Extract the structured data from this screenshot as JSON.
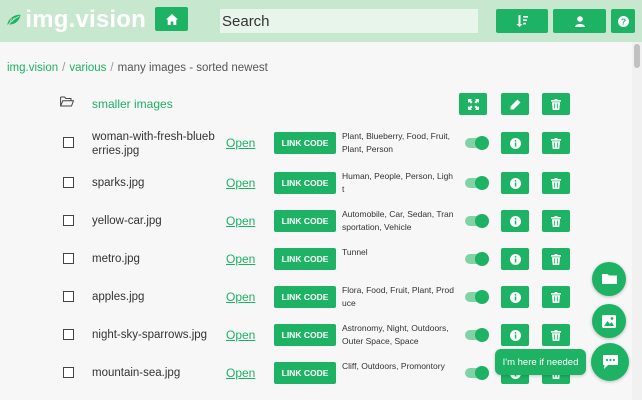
{
  "header": {
    "logo_text": "img.vision",
    "search_placeholder": "Search",
    "icons": [
      "leaf-logo-icon",
      "home-icon",
      "sort-icon",
      "user-icon",
      "help-icon"
    ]
  },
  "breadcrumb": {
    "root": "img.vision",
    "folder": "various",
    "current": "many images - sorted newest",
    "separator": "/"
  },
  "folder_row": {
    "label": "smaller images",
    "actions": [
      "expand-icon",
      "edit-icon",
      "trash-icon"
    ]
  },
  "open_label": "Open",
  "link_code_label": "LINK CODE",
  "files": [
    {
      "name": "woman-with-fresh-blueberries.jpg",
      "tags": "Plant, Blueberry, Food, Fruit, Plant, Person"
    },
    {
      "name": "sparks.jpg",
      "tags": "Human, People, Person, Light"
    },
    {
      "name": "yellow-car.jpg",
      "tags": "Automobile, Car, Sedan, Transportation, Vehicle"
    },
    {
      "name": "metro.jpg",
      "tags": "Tunnel"
    },
    {
      "name": "apples.jpg",
      "tags": "Flora, Food, Fruit, Plant, Produce"
    },
    {
      "name": "night-sky-sparrows.jpg",
      "tags": "Astronomy, Night, Outdoors, Outer Space, Space"
    },
    {
      "name": "mountain-sea.jpg",
      "tags": "Cliff, Outdoors, Promontory"
    }
  ],
  "chat": {
    "bubble_text": "I'm here if needed"
  },
  "colors": {
    "accent": "#1db264",
    "header_bg": "#c7e8cf",
    "search_bg": "#e8f5ea",
    "page_bg": "#f7f7f7"
  }
}
